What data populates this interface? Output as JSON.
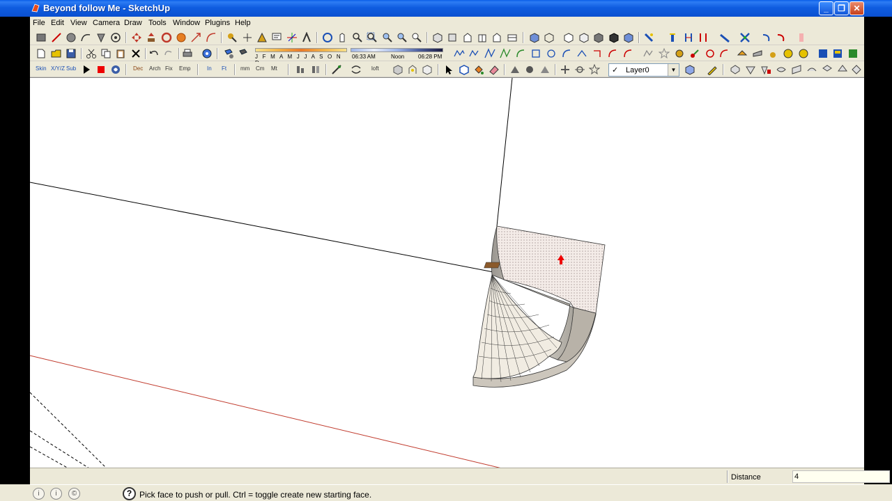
{
  "window": {
    "title": "Beyond follow Me - SketchUp",
    "minimize_glyph": "_",
    "maximize_glyph": "❐",
    "close_glyph": "✕"
  },
  "menu": {
    "items": [
      "File",
      "Edit",
      "View",
      "Camera",
      "Draw",
      "Tools",
      "Window",
      "Plugins",
      "Help"
    ]
  },
  "shadow": {
    "months_label": "J F M A M J J A S O N D",
    "time_start": "06:33 AM",
    "time_noon": "Noon",
    "time_end": "06:28 PM"
  },
  "toolbar3_labels": {
    "skin": "Skin",
    "xyz": "X/Y/Z",
    "sub": "Sub",
    "dec": "Dec",
    "arch": "Arch",
    "fix": "Fix",
    "emp": "Emp",
    "in": "In",
    "ft": "Ft",
    "mm": "mm",
    "cm": "Cm",
    "mt": "Mt",
    "loft": "loft"
  },
  "layer": {
    "check": "✓",
    "name": "Layer0",
    "arrow": "▼"
  },
  "measurements": {
    "label": "Distance",
    "value": "4"
  },
  "status": {
    "help_glyph": "?",
    "message": "Pick face to push or pull.  Ctrl = toggle create new starting face."
  },
  "colors": {
    "accent_blue": "#0a5ee8",
    "axis_red": "#c0392b",
    "selected_face": "#f2e7e3"
  }
}
